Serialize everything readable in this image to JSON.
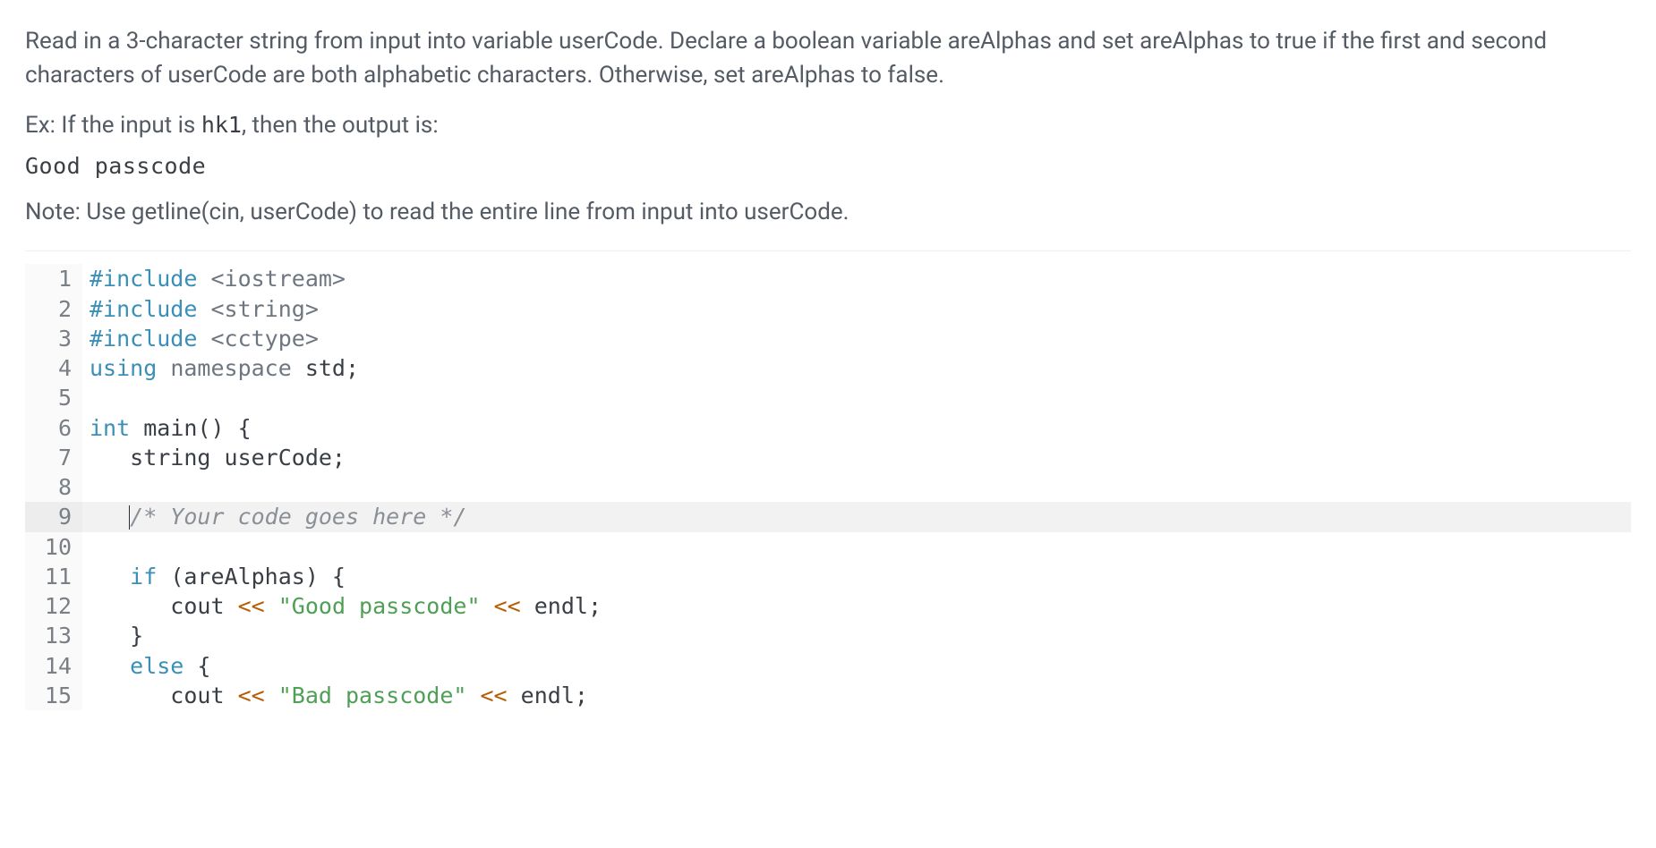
{
  "problem": {
    "description": "Read in a 3-character string from input into variable userCode. Declare a boolean variable areAlphas and set areAlphas to true if the first and second characters of userCode are both alphabetic characters. Otherwise, set areAlphas to false.",
    "example_prefix": "Ex: If the input is ",
    "example_input": "hk1",
    "example_suffix": ", then the output is:",
    "expected_output": "Good passcode",
    "note": "Note: Use getline(cin, userCode) to read the entire line from input into userCode."
  },
  "editor": {
    "active_line": 9,
    "lines": [
      {
        "n": 1,
        "tokens": [
          {
            "t": "#include ",
            "c": "pp"
          },
          {
            "t": "<iostream>",
            "c": "hdr"
          }
        ]
      },
      {
        "n": 2,
        "tokens": [
          {
            "t": "#include ",
            "c": "pp"
          },
          {
            "t": "<string>",
            "c": "hdr"
          }
        ]
      },
      {
        "n": 3,
        "tokens": [
          {
            "t": "#include ",
            "c": "pp"
          },
          {
            "t": "<cctype>",
            "c": "hdr"
          }
        ]
      },
      {
        "n": 4,
        "tokens": [
          {
            "t": "using ",
            "c": "kw"
          },
          {
            "t": "namespace ",
            "c": "nm"
          },
          {
            "t": "std",
            "c": "fn"
          },
          {
            "t": ";",
            "c": "pun"
          }
        ]
      },
      {
        "n": 5,
        "tokens": [
          {
            "t": "",
            "c": ""
          }
        ]
      },
      {
        "n": 6,
        "tokens": [
          {
            "t": "int ",
            "c": "kw"
          },
          {
            "t": "main",
            "c": "fn"
          },
          {
            "t": "() {",
            "c": "pun"
          }
        ]
      },
      {
        "n": 7,
        "tokens": [
          {
            "t": "   string userCode;",
            "c": "fn"
          }
        ]
      },
      {
        "n": 8,
        "tokens": [
          {
            "t": "",
            "c": ""
          }
        ]
      },
      {
        "n": 9,
        "tokens": [
          {
            "t": "   ",
            "c": ""
          },
          {
            "t": "CARET",
            "c": "caret"
          },
          {
            "t": "/* Your code goes here */",
            "c": "cmt"
          }
        ]
      },
      {
        "n": 10,
        "tokens": [
          {
            "t": "",
            "c": ""
          }
        ]
      },
      {
        "n": 11,
        "tokens": [
          {
            "t": "   ",
            "c": ""
          },
          {
            "t": "if ",
            "c": "kw"
          },
          {
            "t": "(areAlphas) {",
            "c": "pun"
          }
        ]
      },
      {
        "n": 12,
        "tokens": [
          {
            "t": "      cout ",
            "c": "fn"
          },
          {
            "t": "<< ",
            "c": "op"
          },
          {
            "t": "\"Good passcode\"",
            "c": "str"
          },
          {
            "t": " << ",
            "c": "op"
          },
          {
            "t": "endl;",
            "c": "fn"
          }
        ]
      },
      {
        "n": 13,
        "tokens": [
          {
            "t": "   }",
            "c": "pun"
          }
        ]
      },
      {
        "n": 14,
        "tokens": [
          {
            "t": "   ",
            "c": ""
          },
          {
            "t": "else ",
            "c": "kw"
          },
          {
            "t": "{",
            "c": "pun"
          }
        ]
      },
      {
        "n": 15,
        "tokens": [
          {
            "t": "      cout ",
            "c": "fn"
          },
          {
            "t": "<< ",
            "c": "op"
          },
          {
            "t": "\"Bad passcode\"",
            "c": "str"
          },
          {
            "t": " << ",
            "c": "op"
          },
          {
            "t": "endl;",
            "c": "fn"
          }
        ]
      }
    ]
  }
}
